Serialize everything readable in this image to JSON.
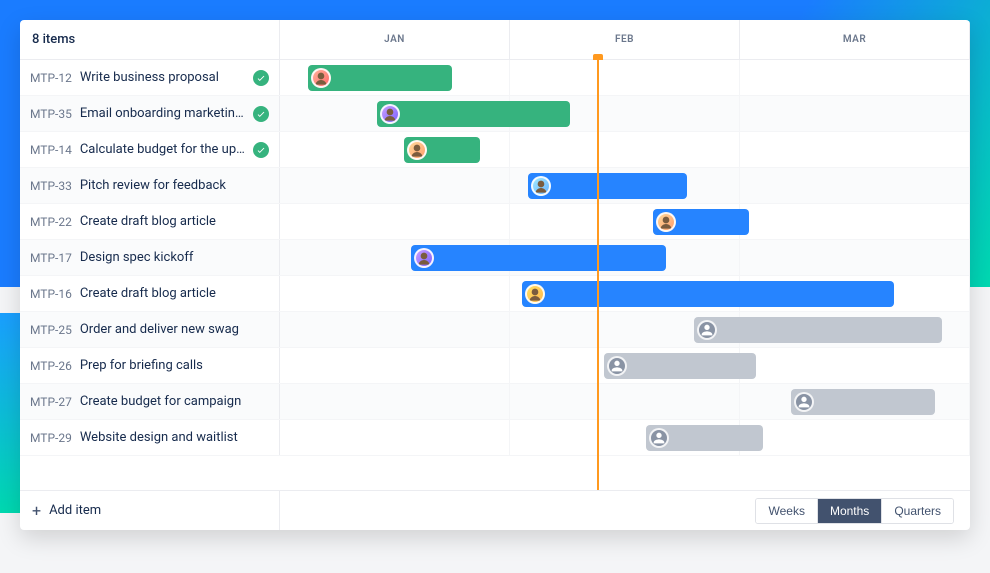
{
  "header": {
    "items_label": "8 items",
    "months": [
      "JAN",
      "FEB",
      "MAR"
    ]
  },
  "today_marker_pct": 46,
  "rows": [
    {
      "key": "MTP-12",
      "title": "Write business proposal",
      "done": true,
      "color": "green",
      "start_pct": 4,
      "width_pct": 21,
      "avatar": "face1"
    },
    {
      "key": "MTP-35",
      "title": "Email onboarding marketing...",
      "done": true,
      "color": "green",
      "start_pct": 14,
      "width_pct": 28,
      "avatar": "face2"
    },
    {
      "key": "MTP-14",
      "title": "Calculate budget for the upc...",
      "done": true,
      "color": "green",
      "start_pct": 18,
      "width_pct": 11,
      "avatar": "face3"
    },
    {
      "key": "MTP-33",
      "title": "Pitch review for feedback",
      "done": false,
      "color": "blue",
      "start_pct": 36,
      "width_pct": 23,
      "avatar": "face4"
    },
    {
      "key": "MTP-22",
      "title": "Create draft blog article",
      "done": false,
      "color": "blue",
      "start_pct": 54,
      "width_pct": 14,
      "avatar": "face3"
    },
    {
      "key": "MTP-17",
      "title": "Design spec kickoff",
      "done": false,
      "color": "blue",
      "start_pct": 19,
      "width_pct": 37,
      "avatar": "face2"
    },
    {
      "key": "MTP-16",
      "title": "Create draft blog article",
      "done": false,
      "color": "blue",
      "start_pct": 35,
      "width_pct": 54,
      "avatar": "face5"
    },
    {
      "key": "MTP-25",
      "title": "Order and deliver new swag",
      "done": false,
      "color": "grey",
      "start_pct": 60,
      "width_pct": 36,
      "avatar": "grey"
    },
    {
      "key": "MTP-26",
      "title": "Prep for briefing calls",
      "done": false,
      "color": "grey",
      "start_pct": 47,
      "width_pct": 22,
      "avatar": "grey"
    },
    {
      "key": "MTP-27",
      "title": "Create budget for campaign",
      "done": false,
      "color": "grey",
      "start_pct": 74,
      "width_pct": 21,
      "avatar": "grey"
    },
    {
      "key": "MTP-29",
      "title": "Website design and waitlist",
      "done": false,
      "color": "grey",
      "start_pct": 53,
      "width_pct": 17,
      "avatar": "grey"
    }
  ],
  "footer": {
    "add_label": "Add item",
    "zoom": {
      "weeks": "Weeks",
      "months": "Months",
      "quarters": "Quarters",
      "active": "months"
    }
  },
  "chart_data": {
    "type": "gantt",
    "title": "",
    "x_axis": {
      "unit": "month",
      "categories": [
        "JAN",
        "FEB",
        "MAR"
      ]
    },
    "today": "early FEB",
    "series": [
      {
        "key": "MTP-12",
        "label": "Write business proposal",
        "status": "done",
        "start": "JAN wk1",
        "end": "JAN wk3"
      },
      {
        "key": "MTP-35",
        "label": "Email onboarding marketing...",
        "status": "done",
        "start": "JAN wk2",
        "end": "FEB wk1"
      },
      {
        "key": "MTP-14",
        "label": "Calculate budget for the upc...",
        "status": "done",
        "start": "JAN wk3",
        "end": "JAN wk4"
      },
      {
        "key": "MTP-33",
        "label": "Pitch review for feedback",
        "status": "in-progress",
        "start": "FEB wk1",
        "end": "FEB wk3"
      },
      {
        "key": "MTP-22",
        "label": "Create draft blog article",
        "status": "in-progress",
        "start": "FEB wk2",
        "end": "FEB wk4"
      },
      {
        "key": "MTP-17",
        "label": "Design spec kickoff",
        "status": "in-progress",
        "start": "JAN wk3",
        "end": "FEB wk3"
      },
      {
        "key": "MTP-16",
        "label": "Create draft blog article",
        "status": "in-progress",
        "start": "FEB wk1",
        "end": "MAR wk3"
      },
      {
        "key": "MTP-25",
        "label": "Order and deliver new swag",
        "status": "todo",
        "start": "FEB wk3",
        "end": "MAR wk4"
      },
      {
        "key": "MTP-26",
        "label": "Prep for briefing calls",
        "status": "todo",
        "start": "FEB wk1",
        "end": "FEB wk4"
      },
      {
        "key": "MTP-27",
        "label": "Create budget for campaign",
        "status": "todo",
        "start": "MAR wk1",
        "end": "MAR wk4"
      },
      {
        "key": "MTP-29",
        "label": "Website design and waitlist",
        "status": "todo",
        "start": "FEB wk2",
        "end": "FEB wk4"
      }
    ]
  }
}
